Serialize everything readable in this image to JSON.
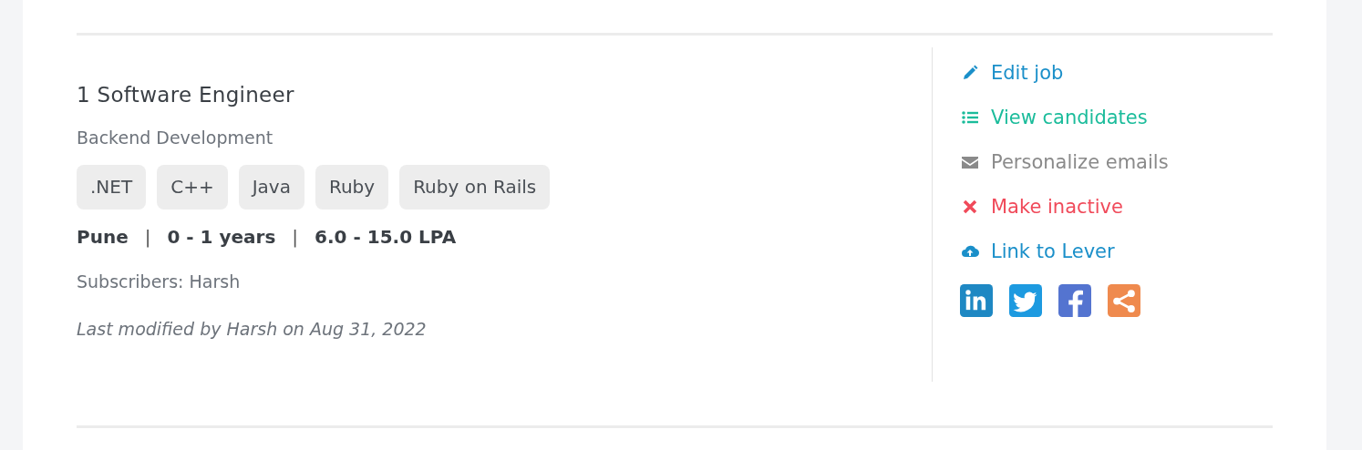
{
  "job": {
    "title": "1 Software Engineer",
    "team": "Backend Development",
    "skills": [
      ".NET",
      "C++",
      "Java",
      "Ruby",
      "Ruby on Rails"
    ],
    "meta": [
      "Pune",
      "|",
      "0 - 1 years",
      "|",
      "6.0 - 15.0 LPA"
    ],
    "subscribers": "Subscribers: Harsh",
    "modified": "Last modified by Harsh on Aug 31, 2022"
  },
  "actions": [
    {
      "kind": "edit",
      "label": "Edit job",
      "color": "#1a8fc9"
    },
    {
      "kind": "list",
      "label": "View candidates",
      "color": "#1bbc9b"
    },
    {
      "kind": "mail",
      "label": "Personalize emails",
      "color": "#8a8a8a"
    },
    {
      "kind": "close",
      "label": "Make inactive",
      "color": "#f04a5a"
    },
    {
      "kind": "upload",
      "label": "Link to Lever",
      "color": "#1a8fc9"
    }
  ],
  "share": [
    {
      "kind": "linkedin",
      "color": "#1e88c3"
    },
    {
      "kind": "twitter",
      "color": "#1d9ae0"
    },
    {
      "kind": "facebook",
      "color": "#5474d0"
    },
    {
      "kind": "share",
      "color": "#ef8a4e"
    }
  ]
}
